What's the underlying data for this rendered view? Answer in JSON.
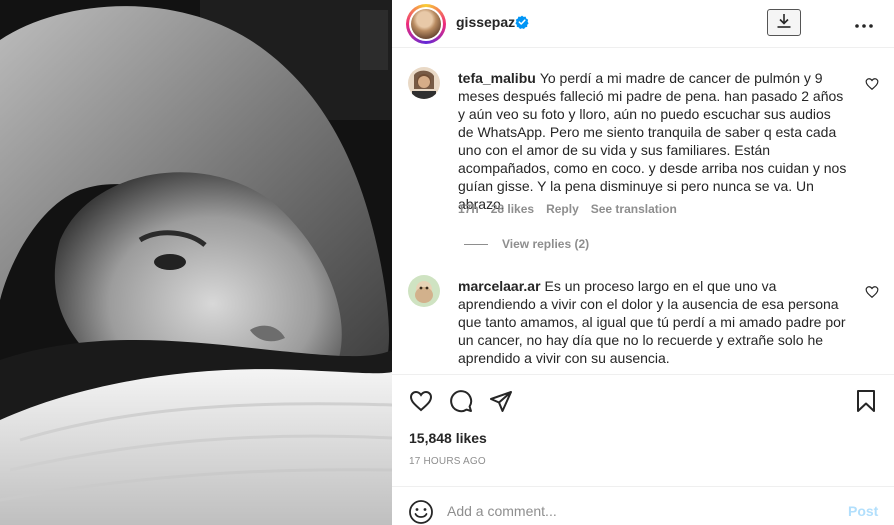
{
  "post": {
    "username": "gissepaz",
    "likes": "15,848 likes",
    "time": "17 HOURS AGO"
  },
  "comments": [
    {
      "username": "tefa_malibu",
      "text": "Yo perdí a mi madre de cancer de pulmón y 9 meses después falleció mi padre de pena. han pasado 2 años y aún veo su foto y lloro, aún no puedo escuchar sus audios de WhatsApp. Pero me siento tranquila de saber q esta cada uno con el amor de su vida y sus familiares. Están acompañados, como en coco. y desde arriba nos cuidan y nos guían gisse. Y la pena disminuye si pero nunca se va. Un abrazo.",
      "age": "17h",
      "likes": "28 likes",
      "reply": "Reply",
      "translate": "See translation",
      "view_replies": "View replies (2)"
    },
    {
      "username": "marcelaar.ar",
      "text": "Es un proceso largo en el que uno va aprendiendo a vivir con el dolor y la ausencia de esa persona que tanto amamos, al igual que tú perdí a mi amado padre por un cancer, no hay día que no lo recuerde y extrañe solo he aprendido a vivir con su ausencia."
    }
  ],
  "add_comment": {
    "placeholder": "Add a comment...",
    "post_label": "Post"
  },
  "colors": {
    "verified": "#0095f6",
    "post_disabled": "#b2dffc",
    "secondary_text": "#8e8e8e"
  },
  "icons": {
    "verified": "verified-badge-icon",
    "download": "download-icon",
    "more": "more-options-icon",
    "heart": "heart-icon",
    "comment": "comment-icon",
    "share": "share-icon",
    "save": "bookmark-icon",
    "emoji": "emoji-icon"
  }
}
